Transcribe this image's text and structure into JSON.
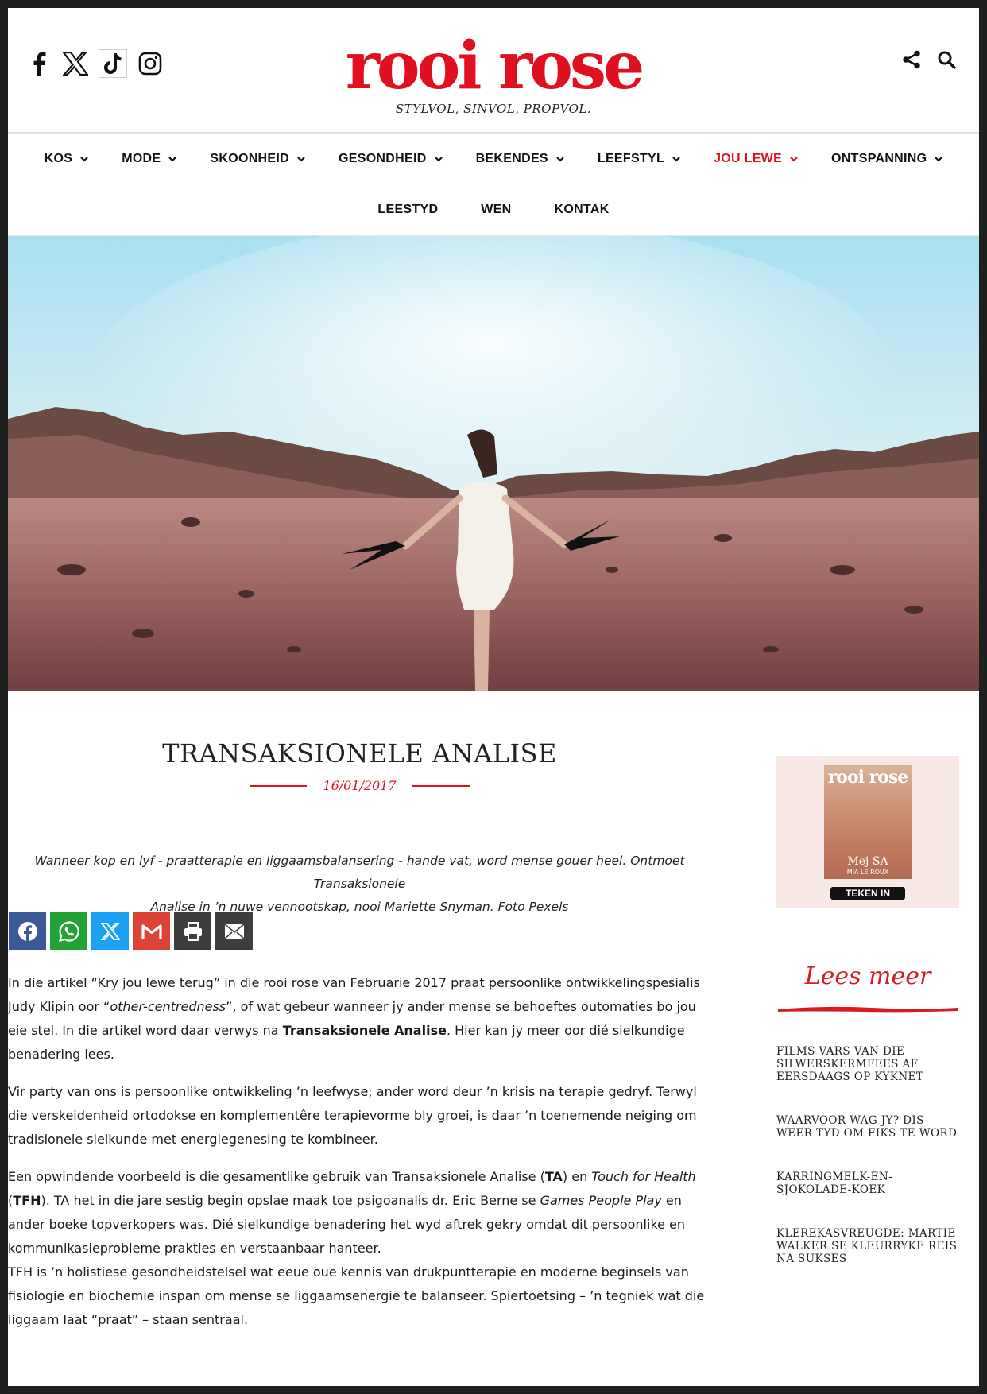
{
  "header": {
    "logo_text": "rooi rose",
    "tagline": "STYLVOL, SINVOL, PROPVOL.",
    "social_icons": [
      "facebook-icon",
      "x-icon",
      "tiktok-icon",
      "instagram-icon"
    ],
    "tool_icons": [
      "share-icon",
      "search-icon"
    ]
  },
  "nav": {
    "row1": [
      {
        "label": "KOS",
        "has_dropdown": true
      },
      {
        "label": "MODE",
        "has_dropdown": true
      },
      {
        "label": "SKOONHEID",
        "has_dropdown": true
      },
      {
        "label": "GESONDHEID",
        "has_dropdown": true
      },
      {
        "label": "BEKENDES",
        "has_dropdown": true
      },
      {
        "label": "LEEFSTYL",
        "has_dropdown": true
      },
      {
        "label": "JOU LEWE",
        "has_dropdown": true,
        "active": true
      },
      {
        "label": "ONTSPANNING",
        "has_dropdown": true
      }
    ],
    "row2": [
      {
        "label": "LEESTYD"
      },
      {
        "label": "WEN"
      },
      {
        "label": "KONTAK"
      }
    ]
  },
  "article": {
    "title": "TRANSAKSIONELE ANALISE",
    "date": "16/01/2017",
    "lede_line1": "Wanneer kop en lyf - praatterapie en liggaamsbalansering - hande vat, word mense gouer heel. Ontmoet Transaksionele",
    "lede_line2": "Analise in ’n nuwe vennootskap, nooi Mariette Snyman. Foto Pexels",
    "share_buttons": [
      {
        "icon": "facebook-icon",
        "color": "#3b5998"
      },
      {
        "icon": "whatsapp-icon",
        "color": "#25a236"
      },
      {
        "icon": "x-icon",
        "color": "#1da1f2"
      },
      {
        "icon": "gmail-icon",
        "color": "#db4437"
      },
      {
        "icon": "print-icon",
        "color": "#3d3d3d"
      },
      {
        "icon": "email-icon",
        "color": "#3d3d3d"
      }
    ],
    "p1": {
      "a": "In die artikel “Kry jou lewe terug” in die rooi rose van Februarie 2017 praat persoonlike ontwikkelingspesialis Judy Klipin oor “",
      "em": "other-centredness",
      "b": "”, of wat gebeur wanneer jy ander mense se behoeftes outomaties bo jou eie stel. In die artikel word daar verwys na ",
      "strong": "Transaksionele Analise",
      "c": ". Hier kan jy meer oor dié sielkundige benadering lees."
    },
    "p2": "Vir party van ons is persoonlike ontwikkeling ’n leefwyse; ander word deur ’n krisis na terapie gedryf. Terwyl die verskeidenheid ortodokse en komplementêre terapievorme bly groei, is daar ’n toenemende neiging om tradisionele sielkunde met energiegenesing te kombineer.",
    "p3": {
      "a": "Een opwindende voorbeeld is die gesamentlike gebruik van Transaksionele Analise (",
      "s1": "TA",
      "b": ") en ",
      "em1": "Touch for Health",
      "c": " (",
      "s2": "TFH",
      "d": "). TA het in die jare sestig begin opslae maak toe psigoanalis dr. Eric Berne se ",
      "em2": "Games People Play",
      "e": " en ander boeke topverkopers was. Dié sielkundige benadering het wyd aftrek gekry omdat dit persoonlike en kommunikasieprobleme prakties en verstaanbaar hanteer."
    },
    "p4": "TFH is ’n holistiese gesondheidstelsel wat eeue oue kennis van drukpuntterapie en moderne beginsels van fisiologie en biochemie inspan om mense se liggaamsenergie te balanseer. Spiertoetsing – ’n tegniek wat die liggaam laat “praat” – staan sentraal."
  },
  "sidebar": {
    "magazine": {
      "cover_logo": "rooi rose",
      "cover_name": "Mej SA",
      "cover_sub": "MIA LE ROUX",
      "cta": "TEKEN IN"
    },
    "lees_meer_heading": "Lees meer",
    "related": [
      "FILMS VARS VAN DIE SILWERSKERMFEES AF EERSDAAGS OP KYKNET",
      "WAARVOOR WAG JY? DIS WEER TYD OM FIKS TE WORD",
      "KARRINGMELK-EN-SJOKOLADE-KOEK",
      "KLEREKASVREUGDE: MARTIE WALKER SE KLEURRYKE REIS NA SUKSES"
    ]
  },
  "colors": {
    "brand_red": "#e01020",
    "text": "#1a1a1a",
    "mag_bg": "#f9e9e6"
  }
}
